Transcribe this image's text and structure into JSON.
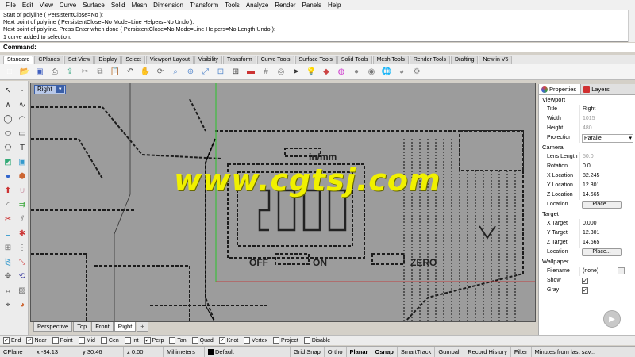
{
  "menu": [
    "File",
    "Edit",
    "View",
    "Curve",
    "Surface",
    "Solid",
    "Mesh",
    "Dimension",
    "Transform",
    "Tools",
    "Analyze",
    "Render",
    "Panels",
    "Help"
  ],
  "command_history": [
    "Start of polyline ( PersistentClose=No ):",
    "Next point of polyline ( PersistentClose=No  Mode=Line  Helpers=No  Undo ):",
    "Next point of polyline. Press Enter when done ( PersistentClose=No  Mode=Line  Helpers=No  Length  Undo ):",
    "1 curve added to selection."
  ],
  "command_prompt": "Command:",
  "toolbar_tabs": [
    "Standard",
    "CPlanes",
    "Set View",
    "Display",
    "Select",
    "Viewport Layout",
    "Visibility",
    "Transform",
    "Curve Tools",
    "Surface Tools",
    "Solid Tools",
    "Mesh Tools",
    "Render Tools",
    "Drafting",
    "New in V5"
  ],
  "toolbar_icons": [
    "new-file-icon",
    "open-icon",
    "save-icon",
    "print-icon",
    "import-icon",
    "cut-icon",
    "copy-icon",
    "paste-icon",
    "undo-icon",
    "pan-icon",
    "rotate-view-icon",
    "zoom-window-icon",
    "zoom-icon",
    "zoom-extents-icon",
    "zoom-selected-icon",
    "four-views-icon",
    "car-icon",
    "grid-icon",
    "osnap-icon",
    "select-icon",
    "light-icon",
    "layers-icon",
    "color-wheel-icon",
    "shaded-icon",
    "rendered-icon",
    "globe-icon",
    "render-icon",
    "options-icon"
  ],
  "left_tools": [
    "select-arrow-icon",
    "point-icon",
    "polyline-icon",
    "curve-icon",
    "circle-icon",
    "arc-icon",
    "ellipse-icon",
    "rectangle-icon",
    "polygon-icon",
    "text-icon",
    "surface-icon",
    "box-icon",
    "sphere-icon",
    "cylinder-icon",
    "extrude-icon",
    "boolean-icon",
    "fillet-icon",
    "offset-icon",
    "trim-icon",
    "split-icon",
    "join-icon",
    "explode-icon",
    "group-icon",
    "array-icon",
    "mirror-icon",
    "scale-icon",
    "move-icon",
    "rotate-icon",
    "dimension-icon",
    "hatch-icon",
    "analyze-icon",
    "render-icon"
  ],
  "viewport": {
    "title": "Right",
    "watermark": "www.cgtsj.com",
    "tabs": [
      "Perspective",
      "Top",
      "Front",
      "Right"
    ],
    "active_tab": "Right"
  },
  "panel": {
    "tabs": [
      "Properties",
      "Layers"
    ],
    "viewport": {
      "header": "Viewport",
      "rows": [
        {
          "k": "Title",
          "v": "Right",
          "dim": false
        },
        {
          "k": "Width",
          "v": "1015",
          "dim": true
        },
        {
          "k": "Height",
          "v": "480",
          "dim": true
        },
        {
          "k": "Projection",
          "v": "Parallel",
          "dim": false
        }
      ]
    },
    "camera": {
      "header": "Camera",
      "rows": [
        {
          "k": "Lens Length",
          "v": "50.0",
          "dim": true
        },
        {
          "k": "Rotation",
          "v": "0.0",
          "dim": false
        },
        {
          "k": "X Location",
          "v": "82.245",
          "dim": false
        },
        {
          "k": "Y Location",
          "v": "12.301",
          "dim": false
        },
        {
          "k": "Z Location",
          "v": "14.665",
          "dim": false
        }
      ],
      "location_label": "Location",
      "place_label": "Place..."
    },
    "target": {
      "header": "Target",
      "rows": [
        {
          "k": "X Target",
          "v": "0.000",
          "dim": false
        },
        {
          "k": "Y Target",
          "v": "12.301",
          "dim": false
        },
        {
          "k": "Z Target",
          "v": "14.665",
          "dim": false
        }
      ],
      "location_label": "Location",
      "place_label": "Place..."
    },
    "wallpaper": {
      "header": "Wallpaper",
      "filename_label": "Filename",
      "filename_value": "(none)",
      "dots": "...",
      "show_label": "Show",
      "gray_label": "Gray"
    }
  },
  "osnaps": [
    {
      "label": "End",
      "checked": true
    },
    {
      "label": "Near",
      "checked": true
    },
    {
      "label": "Point",
      "checked": false
    },
    {
      "label": "Mid",
      "checked": false
    },
    {
      "label": "Cen",
      "checked": false
    },
    {
      "label": "Int",
      "checked": false
    },
    {
      "label": "Perp",
      "checked": true
    },
    {
      "label": "Tan",
      "checked": false
    },
    {
      "label": "Quad",
      "checked": false
    },
    {
      "label": "Knot",
      "checked": true
    },
    {
      "label": "Vertex",
      "checked": false
    },
    {
      "label": "Project",
      "checked": false
    },
    {
      "label": "Disable",
      "checked": false
    }
  ],
  "status": {
    "cplane": "CPlane",
    "x": "x -34.13",
    "y": "y 30.46",
    "z": "z 0.00",
    "units": "Millimeters",
    "layer": "Default",
    "grid_snap": "Grid Snap",
    "ortho": "Ortho",
    "planar": "Planar",
    "osnap": "Osnap",
    "smarttrack": "SmartTrack",
    "gumball": "Gumball",
    "record_history": "Record History",
    "filter": "Filter",
    "message": "Minutes from last sav..."
  },
  "colors": {
    "watermark": "#f0f000",
    "accent": "#3a5fa8",
    "grid_green": "#3fbf3f",
    "axis_red": "#c04040"
  }
}
